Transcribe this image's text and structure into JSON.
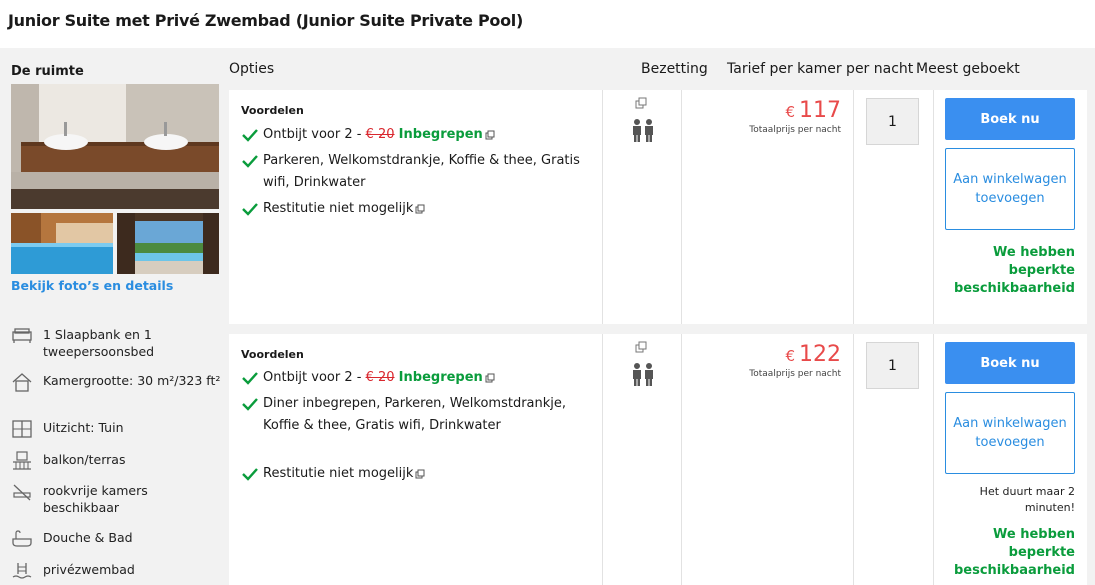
{
  "room_title": "Junior Suite met Privé Zwembad (Junior Suite Private Pool)",
  "headers": {
    "space": "De ruimte",
    "options": "Opties",
    "occupancy": "Bezetting",
    "rate": "Tarief per kamer per nacht",
    "most_booked": "Meest geboekt"
  },
  "photos_link": "Bekijk foto’s en details",
  "amenities": [
    {
      "icon": "bed-icon",
      "label": "1 Slaapbank en 1 tweepersoonsbed"
    },
    {
      "icon": "house-icon",
      "label": "Kamergrootte: 30 m²/323 ft²"
    },
    {
      "icon": "window-icon",
      "label": "Uitzicht: Tuin"
    },
    {
      "icon": "balcony-icon",
      "label": "balkon/terras"
    },
    {
      "icon": "no-smoking-icon",
      "label": "rookvrije kamers beschikbaar"
    },
    {
      "icon": "bathtub-icon",
      "label": "Douche & Bad"
    },
    {
      "icon": "pool-icon",
      "label": "privézwembad"
    }
  ],
  "offers": [
    {
      "benefits_label": "Voordelen",
      "breakfast_text": "Ontbijt voor 2 - ",
      "breakfast_old_price": "€ 20",
      "breakfast_included": "Inbegrepen",
      "extras": "Parkeren, Welkomstdrankje, Koffie & thee, Gratis wifi, Drinkwater",
      "refund": "Restitutie niet mogelijk",
      "currency": "€",
      "price": "117",
      "price_note": "Totaalprijs per nacht",
      "quantity": "1",
      "book_label": "Boek nu",
      "cart_label": "Aan winkelwagen toevoegen",
      "urgency": "",
      "availability": "We hebben beperkte beschikbaarheid"
    },
    {
      "benefits_label": "Voordelen",
      "breakfast_text": "Ontbijt voor 2 - ",
      "breakfast_old_price": "€ 20",
      "breakfast_included": "Inbegrepen",
      "extras": "Diner inbegrepen, Parkeren, Welkomstdrankje, Koffie & thee, Gratis wifi, Drinkwater",
      "refund": "Restitutie niet mogelijk",
      "currency": "€",
      "price": "122",
      "price_note": "Totaalprijs per nacht",
      "quantity": "1",
      "book_label": "Boek nu",
      "cart_label": "Aan winkelwagen toevoegen",
      "urgency": "Het duurt maar 2 minuten!",
      "availability": "We hebben beperkte beschikbaarheid"
    }
  ],
  "colors": {
    "accent": "#3a8ff0",
    "price": "#e84a4a",
    "included": "#0a9c3c",
    "check": "#0a9c3c"
  }
}
